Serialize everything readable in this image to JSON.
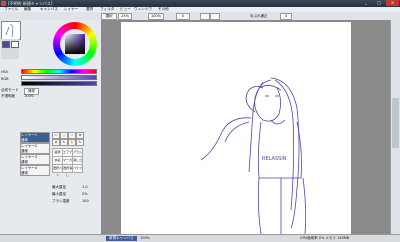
{
  "window": {
    "title": "[不明的 新規キャンバス]",
    "controls": [
      "_",
      "□",
      "×"
    ]
  },
  "menu": [
    "ファイル",
    "編集",
    "キャンバス",
    "レイヤー",
    "選択",
    "フィルタ",
    "ビュー",
    "ウィンドウ",
    "その他"
  ],
  "options": {
    "select_all": "選択",
    "percent": "25%",
    "zoom": "100%",
    "angle": "0",
    "mode_label": "手ぶれ補正",
    "mode_value": "0"
  },
  "left": {
    "hsv": "HSV",
    "rgb": "RGB",
    "blend_label": "合成モード",
    "blend_value": "通常",
    "opacity_label": "不透明度",
    "opacity_value": "100%",
    "layers": [
      {
        "name": "レイヤー1",
        "sub": "通常",
        "selected": true
      },
      {
        "name": "レイヤー2",
        "sub": "通常",
        "selected": false
      },
      {
        "name": "レイヤー3",
        "sub": "通常",
        "selected": false
      },
      {
        "name": "レイヤー4",
        "sub": "通常",
        "selected": false
      }
    ],
    "brushes": [
      "鉛筆",
      "エアブラシ",
      "ブラシ",
      "水彩",
      "マーカー",
      "消しゴム",
      "選択ペン",
      "選択消し",
      "バケツ"
    ],
    "brush_settings": {
      "size_label": "最大直径",
      "size_value": "1.0",
      "min_label": "最小直径",
      "min_value": "0%",
      "density_label": "ブラシ濃度",
      "density_value": "100"
    }
  },
  "canvas": {
    "shirt_text": "RELASSIN"
  },
  "status": {
    "file": "新規キャンバス",
    "zoom": "100%",
    "right": "CPU使用率 0% メモリ 145MB"
  },
  "colors": {
    "sketch": "#4b4aa8",
    "selected_layer": "#3d5c98"
  }
}
